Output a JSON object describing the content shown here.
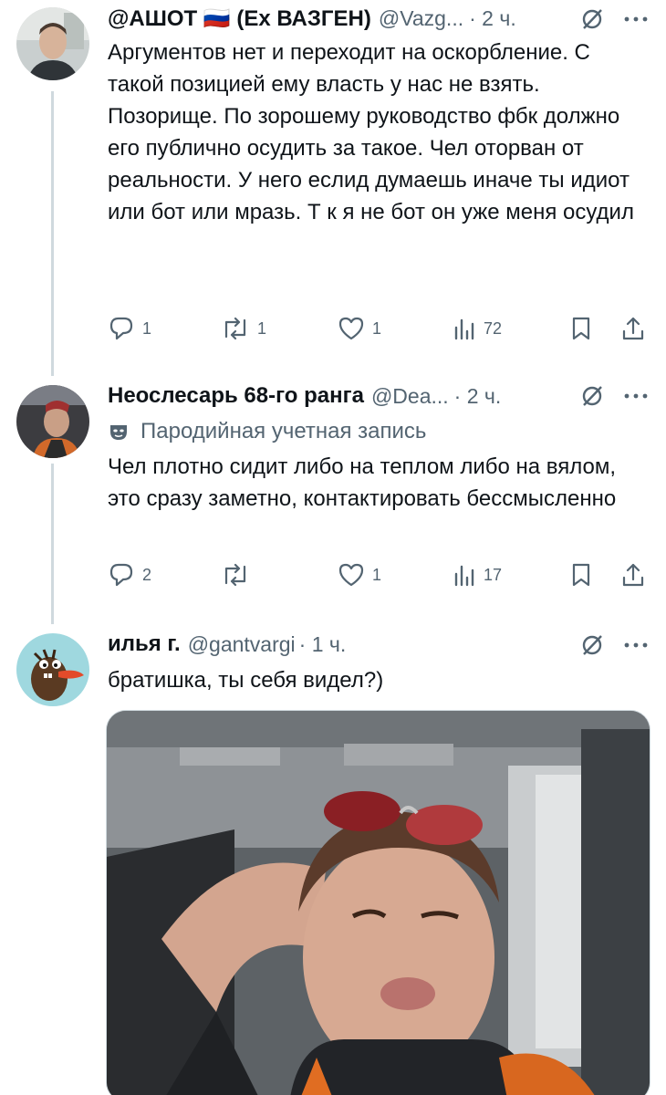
{
  "tweets": [
    {
      "name": "@АШОТ 🇷🇺 (Ex ВАЗГЕН)",
      "handle": "@Vazg...",
      "time": "· 2 ч.",
      "text": "Аргументов нет и переходит на оскорбление. С такой позицией ему власть у нас не взять. Позорище. По зорошему руководство фбк должно его публично осудить за такое. Чел оторван от реальности. У него еслид думаешь иначе ты идиот или бот или мразь. Т к я не бот он уже меня осудил",
      "replies": "1",
      "reposts": "1",
      "likes": "1",
      "views": "72"
    },
    {
      "name": "Неослесарь 68-го ранга",
      "handle": "@Dea...",
      "time": "· 2 ч.",
      "parody_label": "Пародийная учетная запись",
      "text": "Чел плотно сидит либо на теплом либо на вялом, это сразу заметно, контактировать бессмысленно",
      "replies": "2",
      "reposts": "",
      "likes": "1",
      "views": "17"
    },
    {
      "name": "илья г.",
      "handle": "@gantvargi",
      "time": "· 1 ч.",
      "text": "братишка, ты себя видел?)"
    }
  ],
  "colors": {
    "text": "#0f1419",
    "secondary": "#536471",
    "thread_line": "#cfd9de"
  },
  "icons": [
    "reply-icon",
    "repost-icon",
    "like-icon",
    "views-icon",
    "bookmark-icon",
    "share-icon",
    "grok-icon",
    "more-icon",
    "mask-icon"
  ]
}
